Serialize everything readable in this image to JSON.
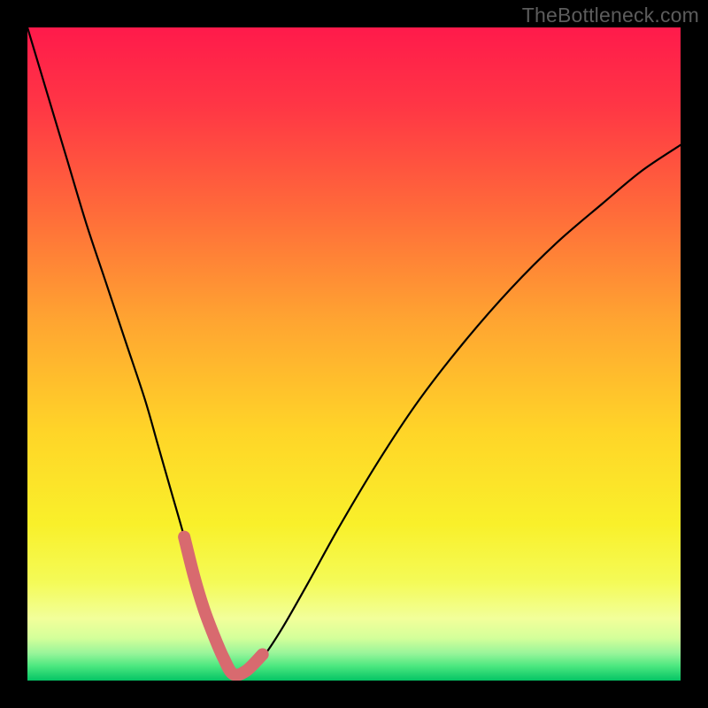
{
  "watermark": "TheBottleneck.com",
  "chart_data": {
    "type": "line",
    "title": "",
    "xlabel": "",
    "ylabel": "",
    "xlim": [
      0,
      100
    ],
    "ylim": [
      0,
      100
    ],
    "grid": false,
    "legend": false,
    "series": [
      {
        "name": "bottleneck-curve",
        "x": [
          0,
          3,
          6,
          9,
          12,
          15,
          18,
          20,
          22,
          24,
          25.5,
          27,
          28.5,
          30,
          31.5,
          33.5,
          36,
          39,
          43,
          48,
          54,
          60,
          67,
          74,
          81,
          88,
          94,
          100
        ],
        "y": [
          100,
          90,
          80,
          70,
          61,
          52,
          43,
          36,
          29,
          22,
          16,
          11,
          7,
          3.5,
          1,
          1,
          3.5,
          8,
          15,
          24,
          34,
          43,
          52,
          60,
          67,
          73,
          78,
          82
        ]
      },
      {
        "name": "highlight-band",
        "x": [
          24,
          25.5,
          27,
          28.5,
          30,
          31.5,
          33.5,
          36
        ],
        "y": [
          22,
          16,
          11,
          7,
          3.5,
          1,
          1.5,
          4
        ]
      }
    ],
    "gradient_stops": [
      {
        "offset": 0.0,
        "color": "#ff1a4b"
      },
      {
        "offset": 0.12,
        "color": "#ff3645"
      },
      {
        "offset": 0.28,
        "color": "#ff6a3a"
      },
      {
        "offset": 0.45,
        "color": "#ffa531"
      },
      {
        "offset": 0.62,
        "color": "#ffd528"
      },
      {
        "offset": 0.76,
        "color": "#f9f02a"
      },
      {
        "offset": 0.85,
        "color": "#f4fb58"
      },
      {
        "offset": 0.905,
        "color": "#f2ff9a"
      },
      {
        "offset": 0.935,
        "color": "#d4ff9a"
      },
      {
        "offset": 0.958,
        "color": "#99f59a"
      },
      {
        "offset": 0.978,
        "color": "#4be77f"
      },
      {
        "offset": 1.0,
        "color": "#05c465"
      }
    ]
  }
}
